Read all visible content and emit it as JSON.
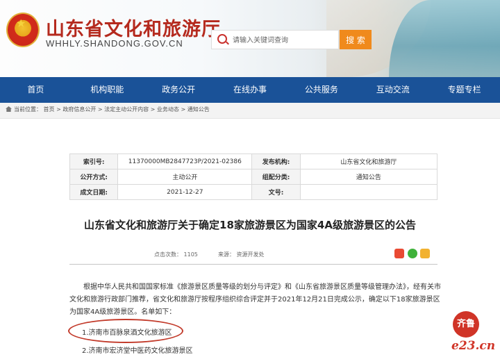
{
  "header": {
    "site_title": "山东省文化和旅游厅",
    "site_url": "WHHLY.SHANDONG.GOV.CN",
    "search_placeholder": "请输入关键词查询",
    "search_button": "搜 索"
  },
  "nav": {
    "items": [
      "首页",
      "机构职能",
      "政务公开",
      "在线办事",
      "公共服务",
      "互动交流",
      "专题专栏"
    ]
  },
  "breadcrumb": "当前位置： 首页 > 政府信息公开 > 法定主动公开内容 > 业务动态 > 通知公告",
  "meta": {
    "index_label": "索引号:",
    "index_value": "11370000MB2847723P/2021-02386",
    "publisher_label": "发布机构:",
    "publisher_value": "山东省文化和旅游厅",
    "mode_label": "公开方式:",
    "mode_value": "主动公开",
    "category_label": "组配分类:",
    "category_value": "通知公告",
    "date_label": "成文日期:",
    "date_value": "2021-12-27",
    "docno_label": "文号:",
    "docno_value": ""
  },
  "article": {
    "title": "山东省文化和旅游厅关于确定18家旅游景区为国家4A级旅游景区的公告",
    "views": "点击次数： 1105",
    "source": "来源： 资源开发处",
    "body": "根据中华人民共和国国家标准《旅游景区质量等级的划分与评定》和《山东省旅游景区质量等级管理办法》，经有关市文化和旅游行政部门推荐，省文化和旅游厅按程序组织综合评定并于2021年12月21日完成公示，确定以下18家旅游景区为国家4A级旅游景区。名单如下：",
    "item1": "1.济南市百脉泉酒文化旅游区",
    "item2": "2.济南市宏济堂中医药文化旅游景区"
  },
  "watermark": {
    "seal": "齐鲁",
    "text": "e23.cn"
  },
  "colors": {
    "nav_bg": "#1a5298",
    "title_red": "#b52a1e",
    "search_orange": "#f08a1c",
    "highlight_red": "#c23a2a"
  }
}
